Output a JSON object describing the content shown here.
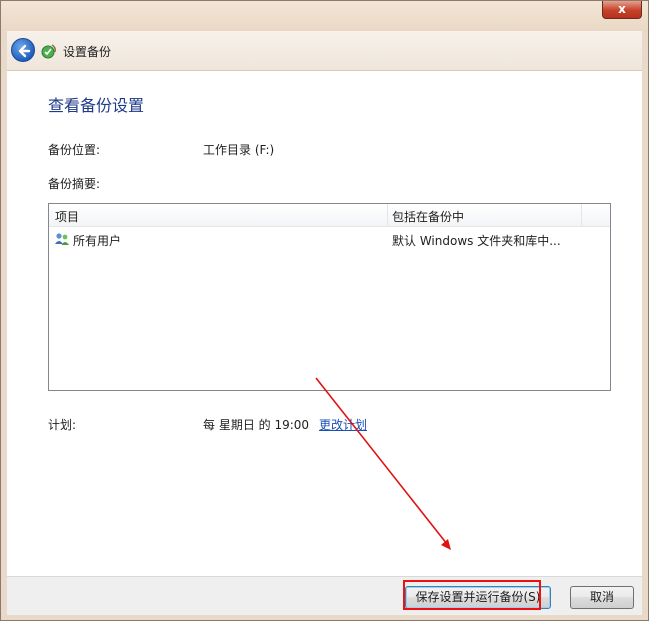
{
  "window": {
    "close_label": "x"
  },
  "nav": {
    "title": "设置备份",
    "back_icon": "back-arrow-icon",
    "app_icon": "backup-icon"
  },
  "content": {
    "heading": "查看备份设置",
    "location_label": "备份位置:",
    "location_value": "工作目录 (F:)",
    "summary_label": "备份摘要:",
    "table": {
      "columns": [
        "项目",
        "包括在备份中"
      ],
      "rows": [
        {
          "item": "所有用户",
          "included": "默认 Windows 文件夹和库中..."
        }
      ]
    },
    "schedule_label": "计划:",
    "schedule_value": "每 星期日 的 19:00",
    "change_schedule_link": "更改计划"
  },
  "footer": {
    "primary_button": "保存设置并运行备份(S)",
    "cancel_button": "取消"
  },
  "colors": {
    "heading": "#1e3a8a",
    "link": "#1a4fb5",
    "annotation": "#e11111"
  }
}
